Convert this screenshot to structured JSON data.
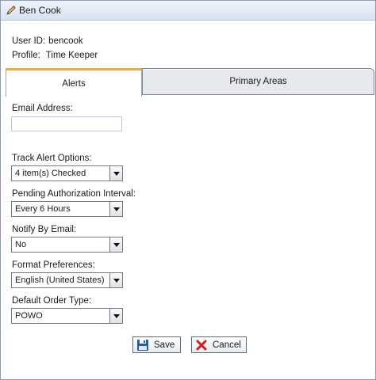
{
  "window": {
    "title": "Ben Cook"
  },
  "user": {
    "id_label": "User ID:",
    "id_value": "bencook",
    "profile_label": "Profile:",
    "profile_value": "Time Keeper"
  },
  "tabs": [
    {
      "label": "Alerts",
      "active": true
    },
    {
      "label": "Primary Areas",
      "active": false
    }
  ],
  "form": {
    "email": {
      "label": "Email Address:",
      "value": ""
    },
    "track_alert_options": {
      "label": "Track Alert Options:",
      "value": "4  item(s) Checked"
    },
    "pending_authorization_interval": {
      "label": "Pending Authorization Interval:",
      "value": "Every 6 Hours"
    },
    "notify_by_email": {
      "label": "Notify By Email:",
      "value": "No"
    },
    "format_preferences": {
      "label": "Format Preferences:",
      "value": "English (United States)"
    },
    "default_order_type": {
      "label": "Default Order Type:",
      "value": "POWO"
    }
  },
  "buttons": {
    "save": "Save",
    "cancel": "Cancel"
  },
  "colors": {
    "active_tab_accent": "#f3ad3a",
    "titlebar": "#dde6f2",
    "save_icon": "#1f5fa8",
    "cancel_icon": "#d21f1f"
  }
}
